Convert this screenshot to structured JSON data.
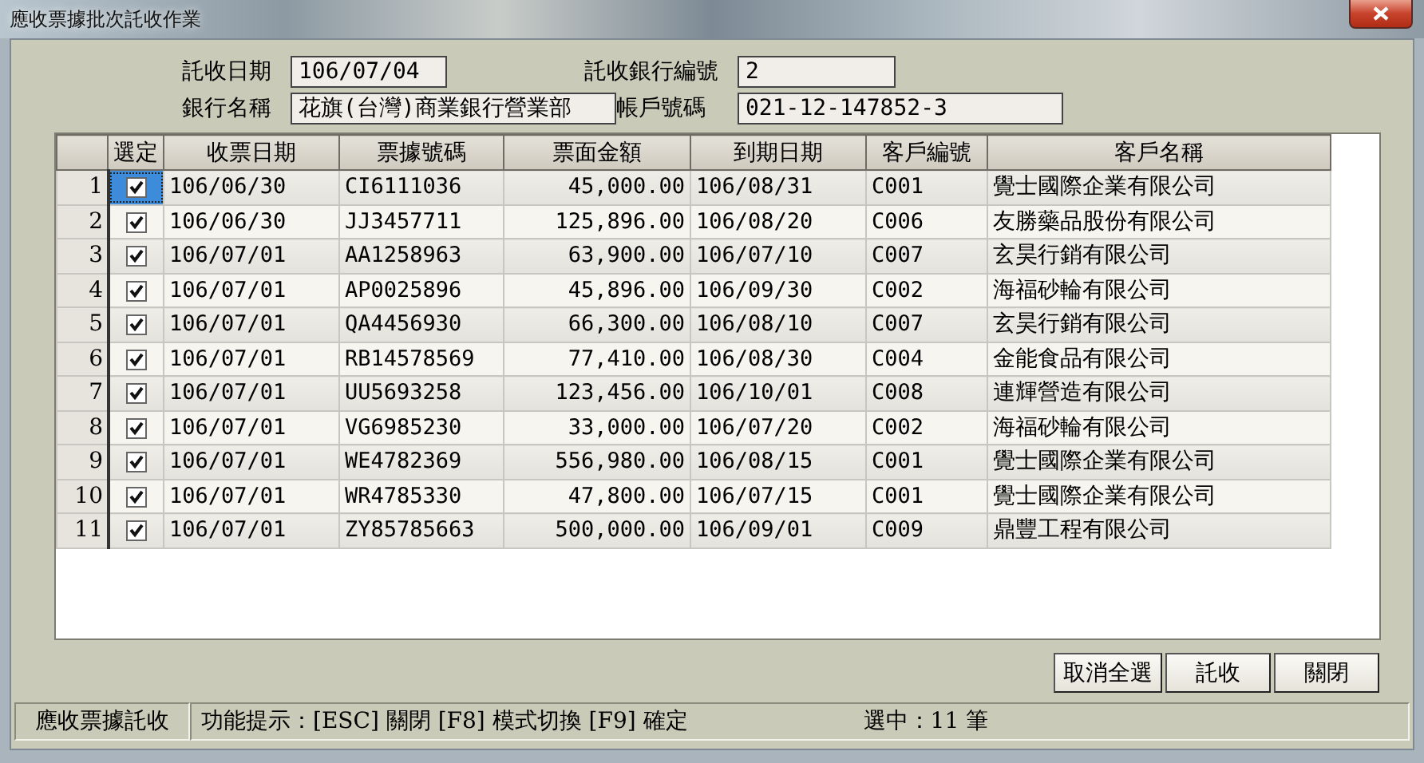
{
  "window": {
    "title": "應收票據批次託收作業"
  },
  "form": {
    "fields": [
      {
        "label": "託收日期",
        "value": "106/07/04"
      },
      {
        "label": "託收銀行編號",
        "value": "2"
      },
      {
        "label": "銀行名稱",
        "value": "花旗(台灣)商業銀行營業部"
      },
      {
        "label": "帳戶號碼",
        "value": "021-12-147852-3"
      }
    ]
  },
  "table": {
    "select_header": "選定",
    "columns": [
      "收票日期",
      "票據號碼",
      "票面金額",
      "到期日期",
      "客戶編號",
      "客戶名稱"
    ],
    "rows": [
      {
        "number": "1",
        "checked": true,
        "selected": true,
        "cells": [
          "106/06/30",
          "CI6111036",
          "45,000.00",
          "106/08/31",
          "C001",
          "覺士國際企業有限公司"
        ]
      },
      {
        "number": "2",
        "checked": true,
        "selected": false,
        "cells": [
          "106/06/30",
          "JJ3457711",
          "125,896.00",
          "106/08/20",
          "C006",
          "友勝藥品股份有限公司"
        ]
      },
      {
        "number": "3",
        "checked": true,
        "selected": false,
        "cells": [
          "106/07/01",
          "AA1258963",
          "63,900.00",
          "106/07/10",
          "C007",
          "玄昊行銷有限公司"
        ]
      },
      {
        "number": "4",
        "checked": true,
        "selected": false,
        "cells": [
          "106/07/01",
          "AP0025896",
          "45,896.00",
          "106/09/30",
          "C002",
          "海福砂輪有限公司"
        ]
      },
      {
        "number": "5",
        "checked": true,
        "selected": false,
        "cells": [
          "106/07/01",
          "QA4456930",
          "66,300.00",
          "106/08/10",
          "C007",
          "玄昊行銷有限公司"
        ]
      },
      {
        "number": "6",
        "checked": true,
        "selected": false,
        "cells": [
          "106/07/01",
          "RB14578569",
          "77,410.00",
          "106/08/30",
          "C004",
          "金能食品有限公司"
        ]
      },
      {
        "number": "7",
        "checked": true,
        "selected": false,
        "cells": [
          "106/07/01",
          "UU5693258",
          "123,456.00",
          "106/10/01",
          "C008",
          "連輝營造有限公司"
        ]
      },
      {
        "number": "8",
        "checked": true,
        "selected": false,
        "cells": [
          "106/07/01",
          "VG6985230",
          "33,000.00",
          "106/07/20",
          "C002",
          "海福砂輪有限公司"
        ]
      },
      {
        "number": "9",
        "checked": true,
        "selected": false,
        "cells": [
          "106/07/01",
          "WE4782369",
          "556,980.00",
          "106/08/15",
          "C001",
          "覺士國際企業有限公司"
        ]
      },
      {
        "number": "10",
        "checked": true,
        "selected": false,
        "cells": [
          "106/07/01",
          "WR4785330",
          "47,800.00",
          "106/07/15",
          "C001",
          "覺士國際企業有限公司"
        ]
      },
      {
        "number": "11",
        "checked": true,
        "selected": false,
        "cells": [
          "106/07/01",
          "ZY85785663",
          "500,000.00",
          "106/09/01",
          "C009",
          "鼎豐工程有限公司"
        ]
      }
    ]
  },
  "buttons": [
    "取消全選",
    "託收",
    "關閉"
  ],
  "status_bar": {
    "module": "應收票據託收",
    "hint": "功能提示：[ESC] 關閉 [F8] 模式切換 [F9] 確定",
    "count": "選中：11 筆"
  }
}
